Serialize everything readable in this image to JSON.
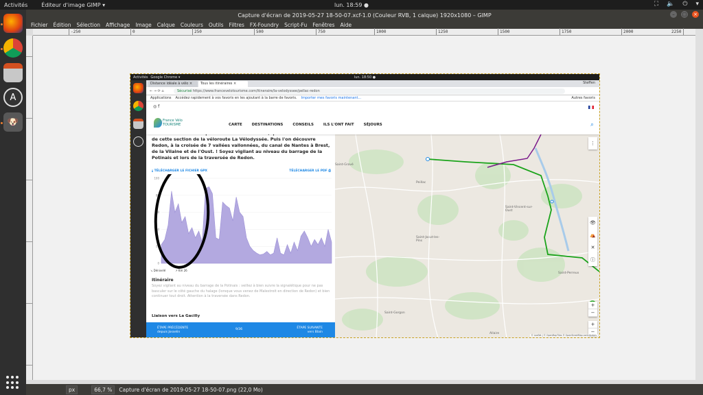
{
  "topbar": {
    "activities": "Activités",
    "app_menu": "Éditeur d'image GIMP ▾",
    "clock": "lun. 18:59 ●"
  },
  "gimp": {
    "title": "Capture d'écran de 2019-05-27 18-50-07.xcf-1.0 (Couleur RVB, 1 calque) 1920x1080 – GIMP",
    "menu": [
      "Fichier",
      "Édition",
      "Sélection",
      "Affichage",
      "Image",
      "Calque",
      "Couleurs",
      "Outils",
      "Filtres",
      "FX-Foundry",
      "Script-Fu",
      "Fenêtres",
      "Aide"
    ],
    "ruler_ticks": [
      "-250",
      "0",
      "250",
      "500",
      "750",
      "1000",
      "1250",
      "1500",
      "1750",
      "2000",
      "2250"
    ],
    "status": {
      "unit": "px",
      "zoom": "66,7 %",
      "file": "Capture d'écran de 2019-05-27 18-50-07.png (22,0 Mo)"
    }
  },
  "inner": {
    "topbar": {
      "activities": "Activités",
      "app": "Google Chrome ▾",
      "clock": "lun. 18:50 ●"
    },
    "chrome": {
      "tabs": [
        "Distance idéale à vélo ×",
        "Tous les itinéraires ×"
      ],
      "user": "Steffen",
      "secure": "Sécurisé",
      "url": "https://www.francevelotourisme.com/itineraire/la-velodyssee/pellac-redon",
      "bookmarks_label": "Applications",
      "bookmarks_hint": "Accédez rapidement à vos favoris en les ajoutant à la barre de favoris.",
      "bookmarks_link": "Importer mes favoris maintenant...",
      "other_bookmarks": "Autres favoris"
    },
    "site": {
      "logo_line1": "France Vélo",
      "logo_line2": "TOURISME",
      "nav": [
        "CARTE",
        "DESTINATIONS",
        "CONSEILS",
        "ILS L'ONT FAIT",
        "SÉJOURS"
      ]
    },
    "content": {
      "paragraph": "rocheux lui donne un petit air de Méditerranée, qui fait tout le charme de cette section de la véloroute La Vélodyssée. Puis l'on découvre Redon, à la croisée de 7 vallées vallonnées, du canal de Nantes à Brest, de la Vilaine et de l'Oust. ! Soyez vigilant au niveau du barrage de la Potinais et lors de la traversée de Redon.",
      "download_gpx": "TÉLÉCHARGER LE FICHIER GPX",
      "download_pdf": "TÉLÉCHARGER LE PDF",
      "legend_left": "Dénivelé",
      "legend_right": "Km 26",
      "itinerary_title": "Itinéraire",
      "itinerary_text": "Soyez vigilant au niveau du barrage de la Potinais : veillez à bien suivre la signalétique pour ne pas basculer sur le côté gauche du halage (lorsque vous venez de Malestroit en direction de Redon) et bien continuer tout droit. Attention à la traversée dans Redon.",
      "liaison": "Liaison vers La Gacilly",
      "stage_prev_1": "ÉTAPE PRÉCÉDENTE",
      "stage_prev_2": "depuis Josselin",
      "stage_mid": "9/36",
      "stage_next_1": "ÉTAPE SUIVANTE",
      "stage_next_2": "vers Blain"
    },
    "map": {
      "labels": [
        "Peillac",
        "Saint-Vincent-sur-Oust",
        "Saint-Jacut-les-Pins",
        "Saint-Perreux",
        "Saint-Gorgon",
        "Allaire",
        "Saint-Gravé"
      ],
      "attribution": "© Leaflet | © OpenMapTiles © OpenStreetMap contributors"
    }
  },
  "colors": {
    "accent": "#1e88e5",
    "route_green": "#1aa31a",
    "route_purple": "#7a1a8a",
    "profile_fill": "#b3a9e0"
  },
  "chart_data": {
    "type": "area",
    "title": "",
    "xlabel": "",
    "ylabel": "",
    "ylim": [
      0,
      100
    ],
    "y_ticks": [
      "100",
      "80",
      "60",
      "40",
      "20",
      "0"
    ],
    "x": [
      0,
      2,
      4,
      6,
      8,
      10,
      12,
      14,
      16,
      18,
      20,
      22,
      24,
      26,
      28,
      30,
      32,
      34,
      36,
      38,
      40,
      42,
      44,
      46,
      48,
      50,
      52,
      54,
      56,
      58,
      60,
      62,
      64,
      66,
      68,
      70,
      72,
      74,
      76,
      78,
      80,
      82,
      84,
      86,
      88,
      90,
      92,
      94,
      96,
      98,
      100
    ],
    "series": [
      {
        "values": [
          22,
          28,
          45,
          85,
          60,
          70,
          48,
          55,
          35,
          42,
          30,
          38,
          25,
          88,
          90,
          82,
          30,
          28,
          72,
          68,
          65,
          50,
          78,
          60,
          55,
          30,
          20,
          15,
          12,
          10,
          11,
          14,
          10,
          12,
          30,
          12,
          10,
          22,
          12,
          25,
          15,
          32,
          38,
          30,
          20,
          28,
          22,
          30,
          20,
          40,
          25
        ]
      }
    ]
  }
}
